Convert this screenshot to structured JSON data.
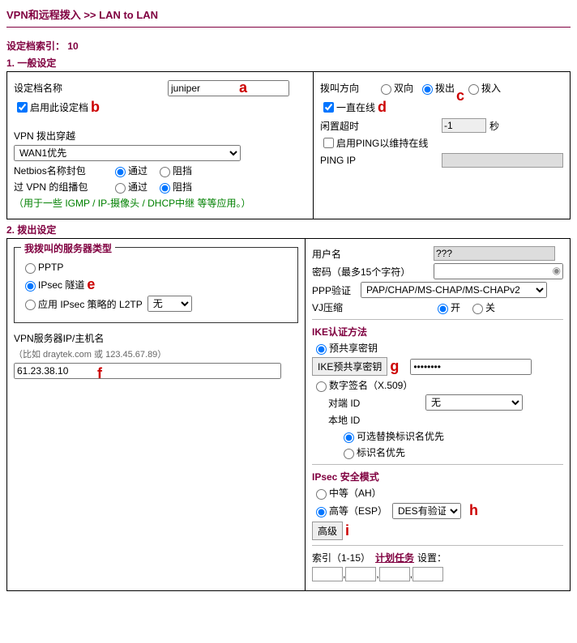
{
  "breadcrumb": "VPN和远程拨入 >> LAN to LAN",
  "profile_index_label": "设定档索引： 10",
  "section1": {
    "title": "1. 一般设定",
    "profile_name_label": "设定档名称",
    "profile_name_value": "juniper",
    "enable_profile_label": "启用此设定档",
    "vpn_dialout_label": "VPN 拨出穿越",
    "wan_options": [
      "WAN1优先"
    ],
    "netbios_label": "Netbios名称封包",
    "pass_label": "通过",
    "block_label": "阻挡",
    "multicast_label": "过 VPN 的组播包",
    "multicast_note": "（用于一些 IGMP / IP-摄像头 / DHCP中继 等等应用。）",
    "dial_dir_label": "拨叫方向",
    "dir_both": "双向",
    "dir_out": "拨出",
    "dir_in": "拨入",
    "always_on_label": "一直在线",
    "idle_label": "闲置超时",
    "idle_value": "-1",
    "idle_unit": "秒",
    "ping_keep_label": "启用PING以维持在线",
    "ping_ip_label": "PING IP",
    "ping_ip_value": ""
  },
  "section2": {
    "title": "2. 拨出设定",
    "server_type_legend": "我拨叫的服务器类型",
    "pptp_label": "PPTP",
    "ipsec_label": "IPsec 隧道",
    "l2tp_label": "应用 IPsec 策略的 L2TP",
    "l2tp_options": [
      "无"
    ],
    "server_ip_label": "VPN服务器IP/主机名",
    "server_ip_hint": "（比如 draytek.com 或 123.45.67.89）",
    "server_ip_value": "61.23.38.10",
    "username_label": "用户名",
    "username_value": "???",
    "password_label": "密码（最多15个字符）",
    "password_value": "",
    "ppp_auth_label": "PPP验证",
    "ppp_auth_options": [
      "PAP/CHAP/MS-CHAP/MS-CHAPv2"
    ],
    "vj_label": "VJ压缩",
    "on_label": "开",
    "off_label": "关",
    "ike_legend": "IKE认证方法",
    "psk_label": "预共享密钥",
    "ike_btn": "IKE预共享密钥",
    "ike_value": "••••••••",
    "sig_label": "数字签名（X.509）",
    "peer_id_label": "对端 ID",
    "peer_id_options": [
      "无"
    ],
    "local_id_label": "本地 ID",
    "alt_subj_label": "可选替换标识名优先",
    "subj_label": "标识名优先",
    "ipsec_mode_legend": "IPsec 安全模式",
    "medium_label": "中等（AH）",
    "high_label": "高等（ESP）",
    "esp_options": [
      "DES有验证"
    ],
    "advanced_btn": "高级",
    "index_label": "索引（1-15）",
    "schedule_label": "计划任务",
    "setup_label": "设置："
  },
  "annotations": {
    "a": "a",
    "b": "b",
    "c": "c",
    "d": "d",
    "e": "e",
    "f": "f",
    "g": "g",
    "h": "h",
    "i": "i"
  }
}
